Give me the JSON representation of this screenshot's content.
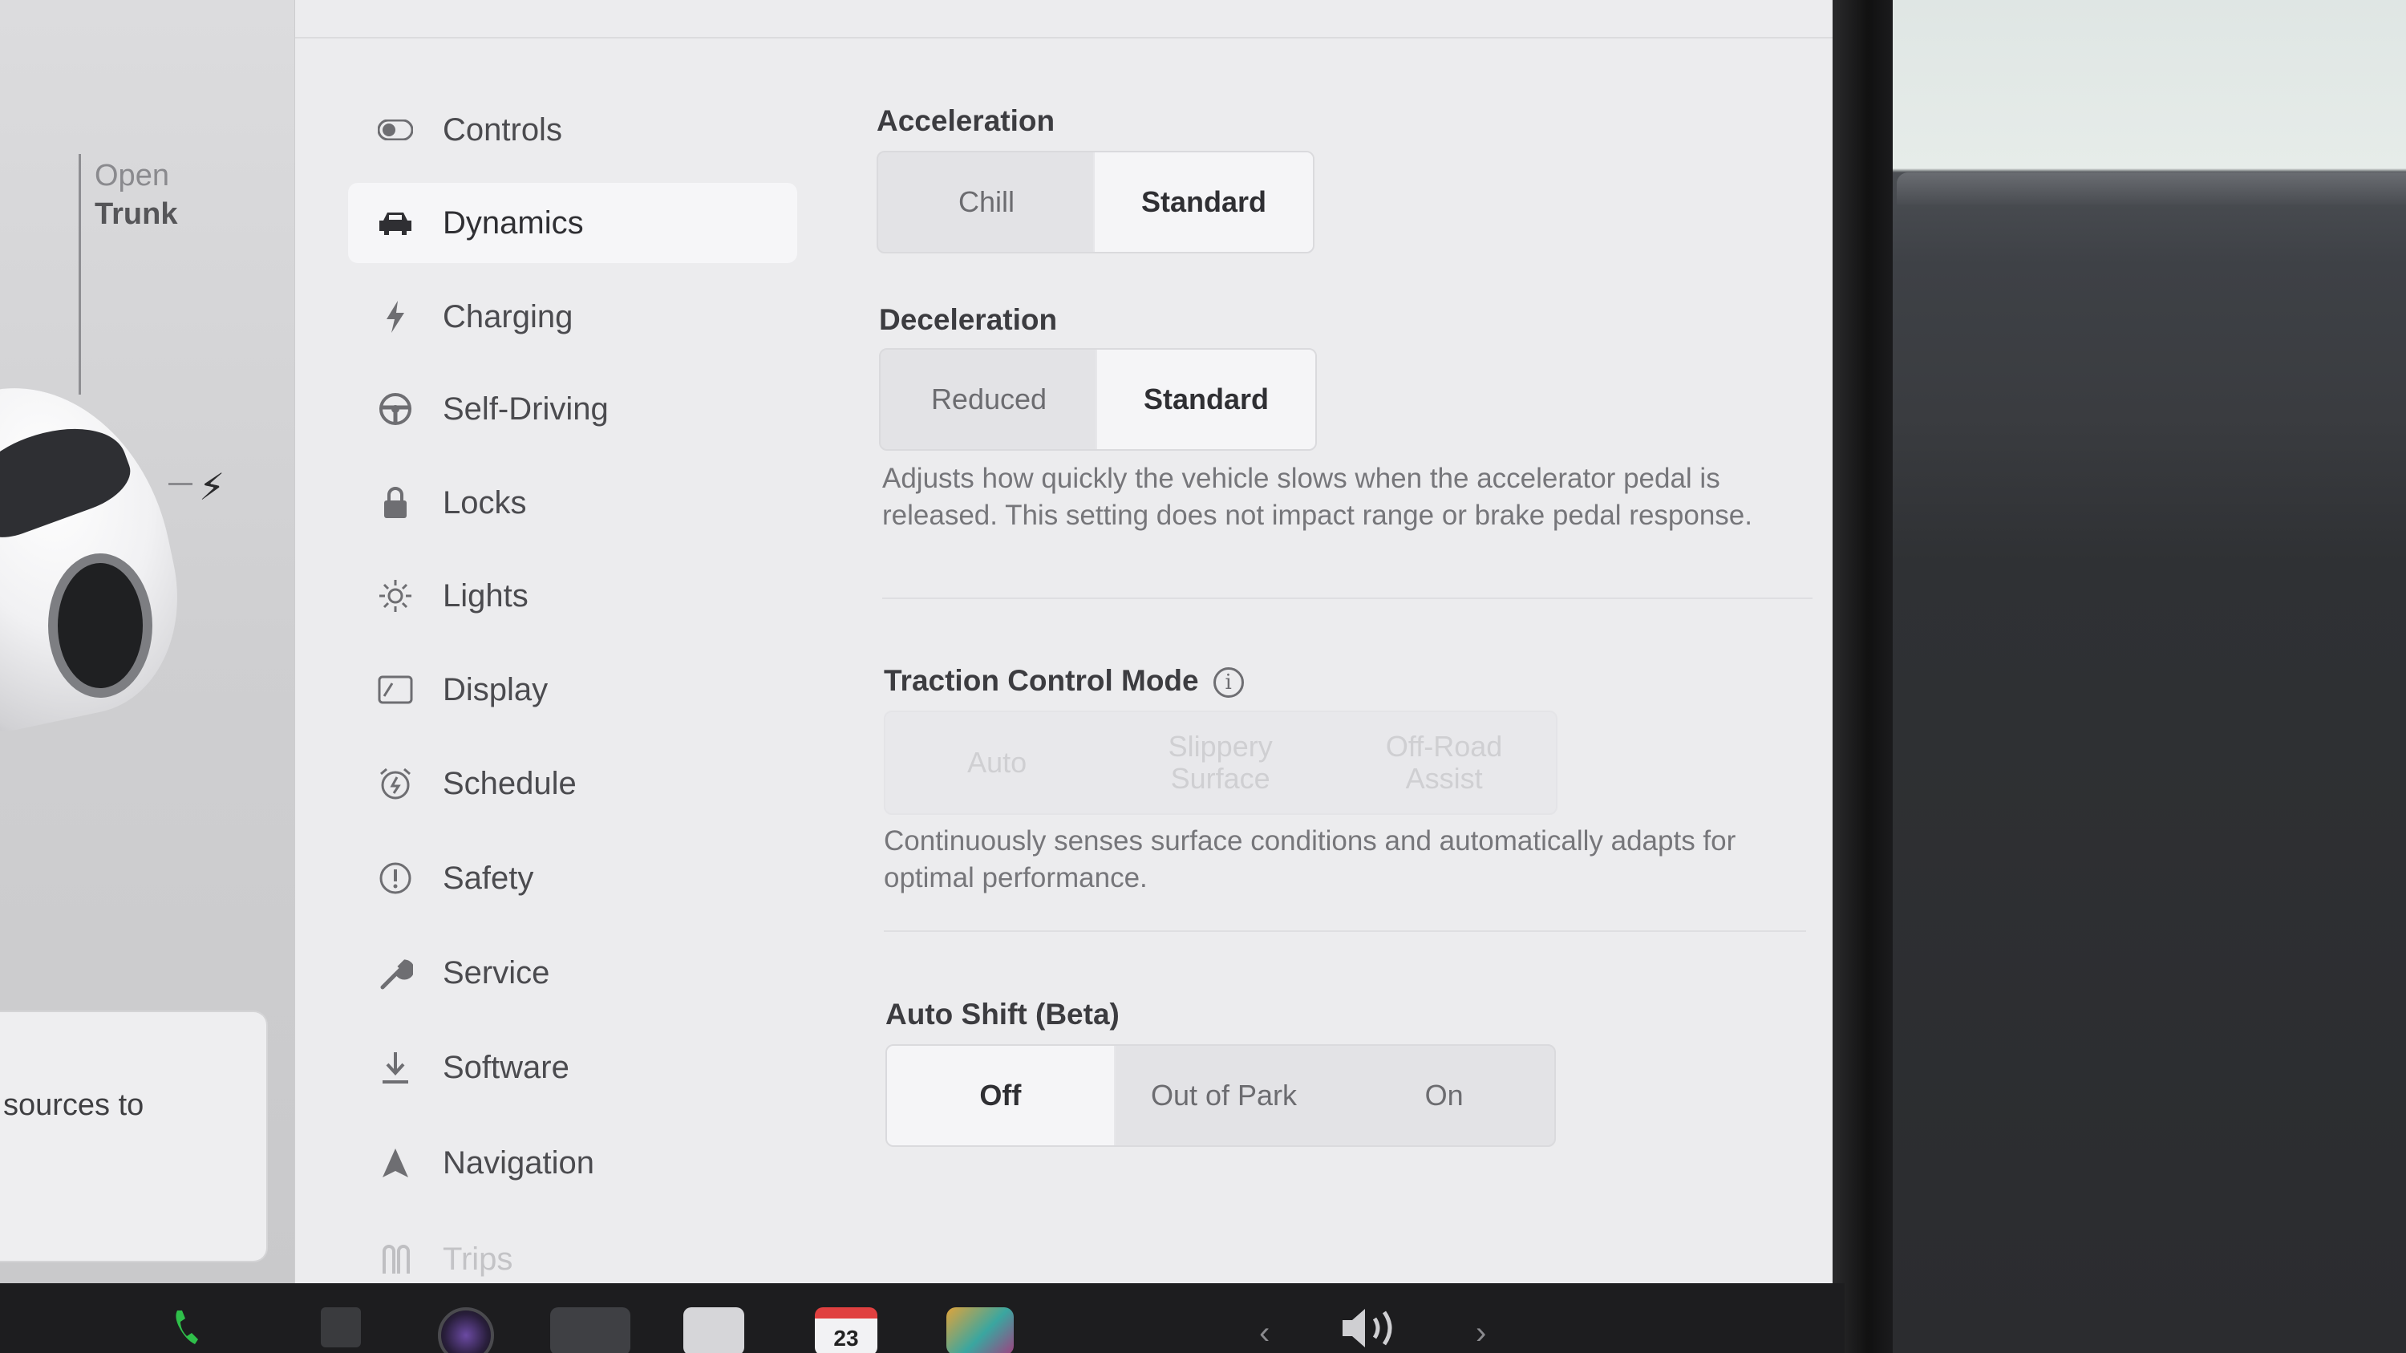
{
  "car_panel": {
    "trunk_line1": "Open",
    "trunk_line2": "Trunk",
    "popup_text": "sources to"
  },
  "sidebar": {
    "items": [
      {
        "label": "Controls",
        "icon": "toggle-icon"
      },
      {
        "label": "Dynamics",
        "icon": "car-icon",
        "active": true
      },
      {
        "label": "Charging",
        "icon": "bolt-icon"
      },
      {
        "label": "Self-Driving",
        "icon": "steering-wheel-icon"
      },
      {
        "label": "Locks",
        "icon": "lock-icon"
      },
      {
        "label": "Lights",
        "icon": "sun-icon"
      },
      {
        "label": "Display",
        "icon": "display-icon"
      },
      {
        "label": "Schedule",
        "icon": "alarm-clock-icon"
      },
      {
        "label": "Safety",
        "icon": "alert-circle-icon"
      },
      {
        "label": "Service",
        "icon": "wrench-icon"
      },
      {
        "label": "Software",
        "icon": "download-icon"
      },
      {
        "label": "Navigation",
        "icon": "navigation-arrow-icon"
      },
      {
        "label": "Trips",
        "icon": "trips-icon"
      }
    ]
  },
  "content": {
    "acceleration": {
      "title": "Acceleration",
      "options": [
        "Chill",
        "Standard"
      ],
      "selected": "Standard"
    },
    "deceleration": {
      "title": "Deceleration",
      "options": [
        "Reduced",
        "Standard"
      ],
      "selected": "Standard",
      "description": "Adjusts how quickly the vehicle slows when the accelerator pedal is released. This setting does not impact range or brake pedal response."
    },
    "traction": {
      "title": "Traction Control Mode",
      "options": [
        "Auto",
        "Slippery Surface",
        "Off-Road Assist"
      ],
      "description": "Continuously senses surface conditions and automatically adapts for optimal performance."
    },
    "auto_shift": {
      "title": "Auto Shift (Beta)",
      "options": [
        "Off",
        "Out of Park",
        "On"
      ],
      "selected": "Off"
    }
  },
  "taskbar": {
    "calendar_day": "23",
    "left_arrow": "‹",
    "right_arrow": "›"
  }
}
